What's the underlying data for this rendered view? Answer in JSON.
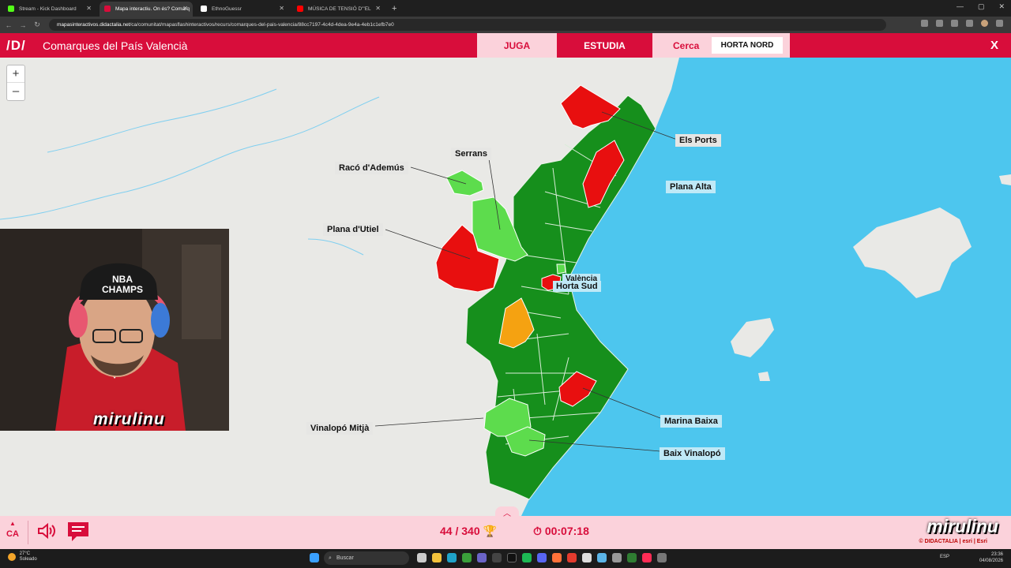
{
  "browser": {
    "tabs": [
      {
        "title": "Stream - Kick Dashboard",
        "color": "#53fc18",
        "active": false
      },
      {
        "title": "Mapa interactiu. On és? Comarq",
        "color": "#d80d3b",
        "active": true
      },
      {
        "title": "EthnoGuessr",
        "color": "#ffffff",
        "active": false
      },
      {
        "title": "MÚSICA DE TENSIÓ D'\"EL",
        "color": "#ff0000",
        "active": false
      }
    ],
    "new_tab": "+",
    "url_host": "mapasinteractivos.didactalia.net",
    "url_path": "/ca/comunitat/mapasflashinteractivos/recurs/comarques-del-pais-valencia/88cc7197-4c4d-4dea-9e4a-4eb1c1efb7e0"
  },
  "app": {
    "logo": "/D/",
    "title": "Comarques del País Valencià",
    "tabs": {
      "juga": "JUGA",
      "estudia": "ESTUDIA"
    },
    "search_label": "Cerca",
    "search_value": "HORTA NORD",
    "close": "X"
  },
  "map": {
    "zoom_in": "+",
    "zoom_out": "–",
    "labels": [
      {
        "text": "Els Ports",
        "sea": false
      },
      {
        "text": "Plana Alta",
        "sea": true
      },
      {
        "text": "Serrans",
        "sea": false
      },
      {
        "text": "Racó d'Ademús",
        "sea": false
      },
      {
        "text": "Plana d'Utiel",
        "sea": false
      },
      {
        "text": "València",
        "sea": true
      },
      {
        "text": "Horta Sud",
        "sea": true
      },
      {
        "text": "Vinalopó Mitjà",
        "sea": false
      },
      {
        "text": "Marina Baixa",
        "sea": true
      },
      {
        "text": "Baix Vinalopó",
        "sea": true
      }
    ],
    "colors": {
      "correct": "#168f1c",
      "correct_light": "#5ddc4d",
      "wrong": "#e80f0f",
      "current": "#f5a211",
      "sea": "#4dc6ee"
    }
  },
  "webcam": {
    "overlay_text": "mirulinu",
    "cap_text": "NBA CHAMPS"
  },
  "status": {
    "lang": "CA",
    "score": "44 / 340",
    "timer": "00:07:18"
  },
  "brand": {
    "name": "mirulinu",
    "credit": "© DIDACTALIA | esri | Esri"
  },
  "taskbar": {
    "temp": "27°C",
    "weather": "Soleado",
    "search_placeholder": "Buscar",
    "lang": "ESP",
    "time": "23:36",
    "date": "04/08/2026"
  }
}
